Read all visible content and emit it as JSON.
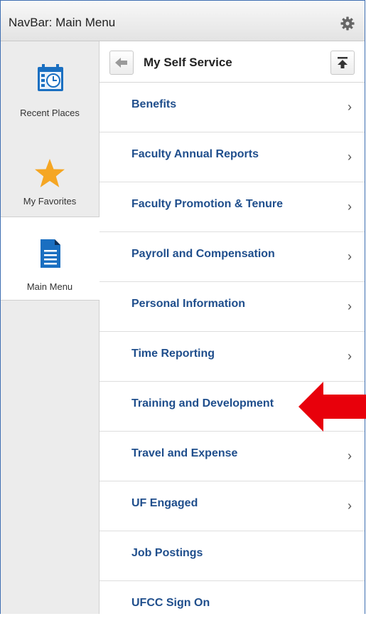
{
  "navbar": {
    "title": "NavBar: Main Menu"
  },
  "sidebar": {
    "items": [
      {
        "label": "Recent Places",
        "icon": "calendar-clock-icon",
        "active": false
      },
      {
        "label": "My Favorites",
        "icon": "star-icon",
        "active": false
      },
      {
        "label": "Main Menu",
        "icon": "document-icon",
        "active": true
      }
    ]
  },
  "panel": {
    "title": "My Self Service",
    "items": [
      {
        "label": "Benefits",
        "has_children": true
      },
      {
        "label": "Faculty Annual Reports",
        "has_children": true
      },
      {
        "label": "Faculty Promotion & Tenure",
        "has_children": true
      },
      {
        "label": "Payroll and Compensation",
        "has_children": true
      },
      {
        "label": "Personal Information",
        "has_children": true
      },
      {
        "label": "Time Reporting",
        "has_children": true
      },
      {
        "label": "Training and Development",
        "has_children": false
      },
      {
        "label": "Travel and Expense",
        "has_children": true
      },
      {
        "label": "UF Engaged",
        "has_children": true
      },
      {
        "label": "Job Postings",
        "has_children": false
      },
      {
        "label": "UFCC Sign On",
        "has_children": false
      }
    ],
    "chevron": "›"
  },
  "colors": {
    "link": "#1f4e8c",
    "accent": "#3f6fb2",
    "callout": "#e8000b",
    "star": "#f5a623"
  }
}
